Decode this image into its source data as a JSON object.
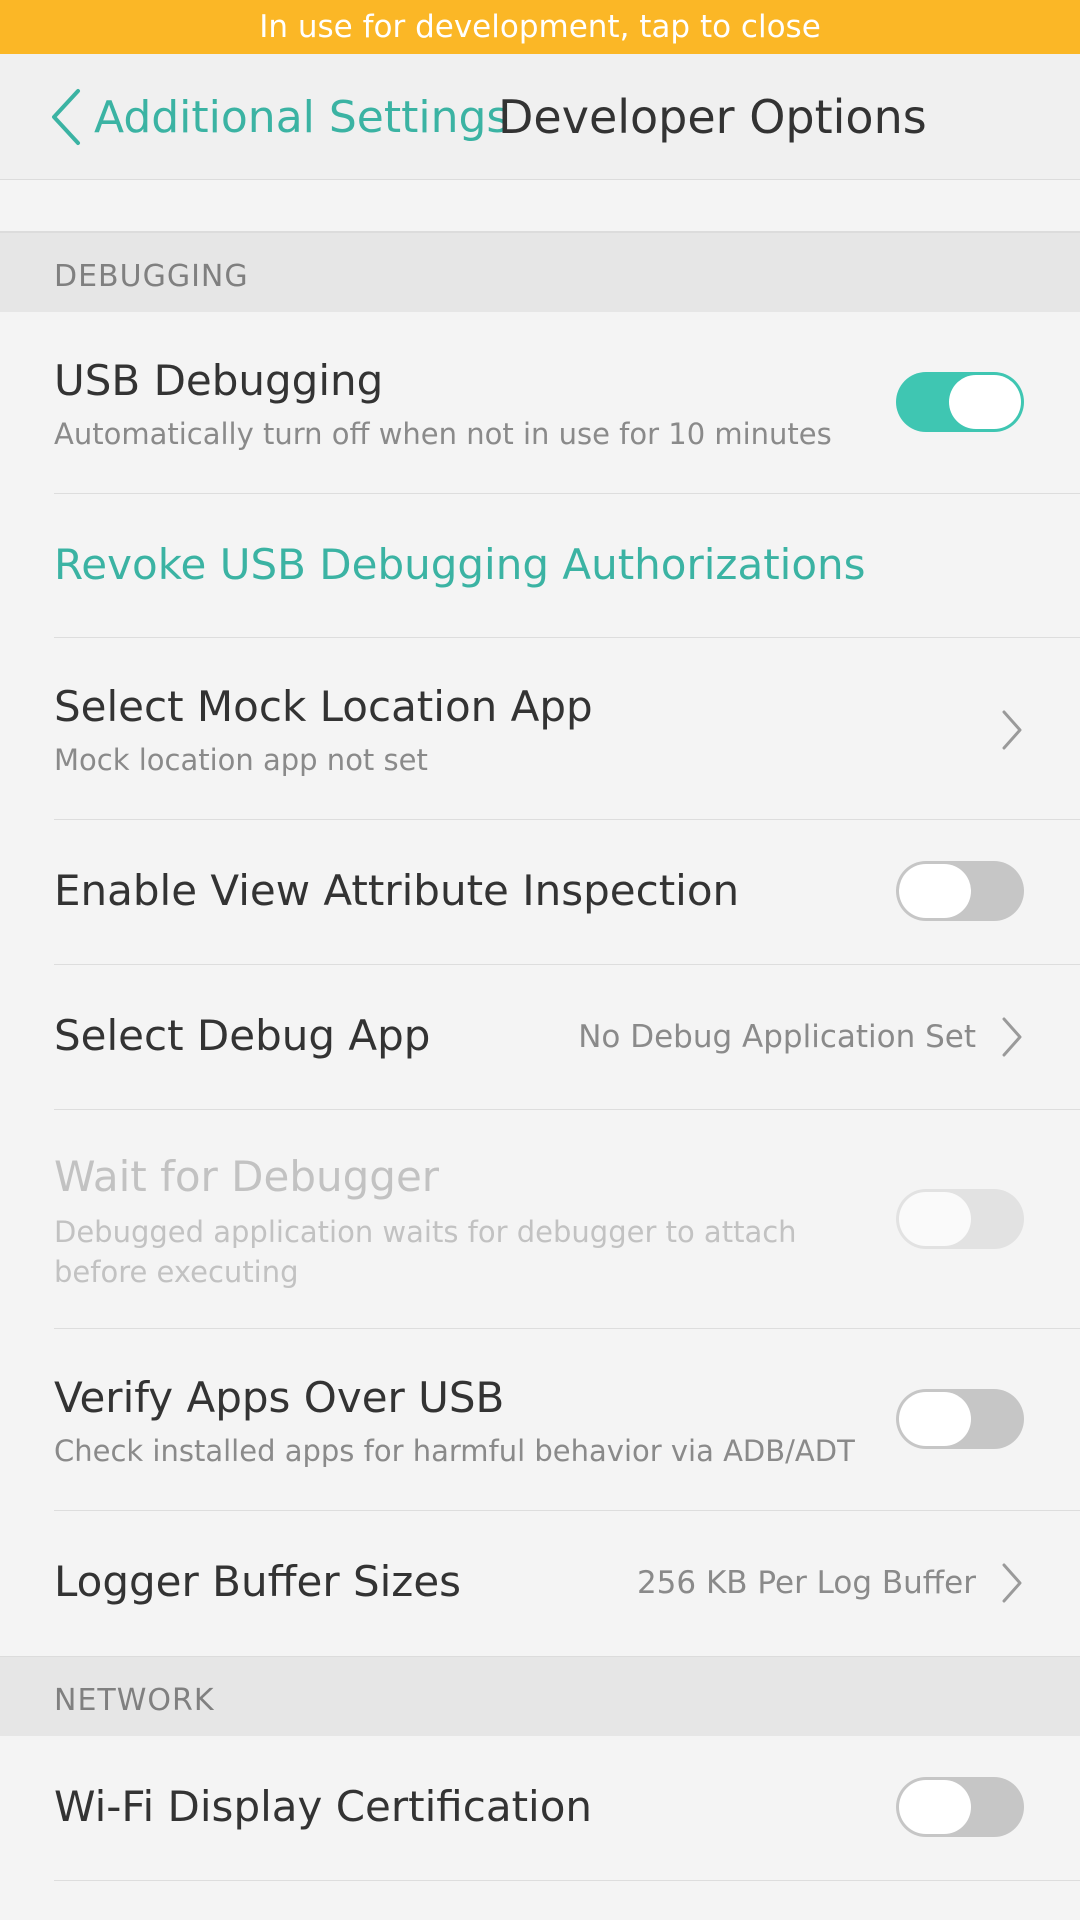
{
  "banner": {
    "text": "In use for development, tap to close",
    "color": "#fbb726"
  },
  "header": {
    "back_label": "Additional Settings",
    "title": "Developer Options",
    "back_icon": "chevron-left-icon",
    "accent_color": "#3bb3a3"
  },
  "sections": {
    "debugging": "DEBUGGING",
    "network": "NETWORK"
  },
  "rows": {
    "usb_debugging": {
      "title": "USB Debugging",
      "subtitle": "Automatically turn off when not in use for 10 minutes",
      "toggle_on": true
    },
    "revoke": {
      "title": "Revoke USB Debugging Authorizations"
    },
    "mock_location": {
      "title": "Select Mock Location App",
      "subtitle": "Mock location app not set"
    },
    "view_attr": {
      "title": "Enable View Attribute Inspection",
      "toggle_on": false
    },
    "debug_app": {
      "title": "Select Debug App",
      "value": "No Debug Application Set"
    },
    "wait_debugger": {
      "title": "Wait for Debugger",
      "subtitle_line1": "Debugged application waits for debugger to attach",
      "subtitle_line2": "before executing",
      "toggle_on": false,
      "enabled": false
    },
    "verify_apps": {
      "title": "Verify Apps Over USB",
      "subtitle": "Check installed apps for harmful behavior via ADB/ADT",
      "toggle_on": false
    },
    "logger": {
      "title": "Logger Buffer Sizes",
      "value": "256 KB Per Log Buffer"
    },
    "wifi_display": {
      "title": "Wi-Fi Display Certification",
      "toggle_on": false
    }
  },
  "toggle_on_color": "#3fc6b2"
}
